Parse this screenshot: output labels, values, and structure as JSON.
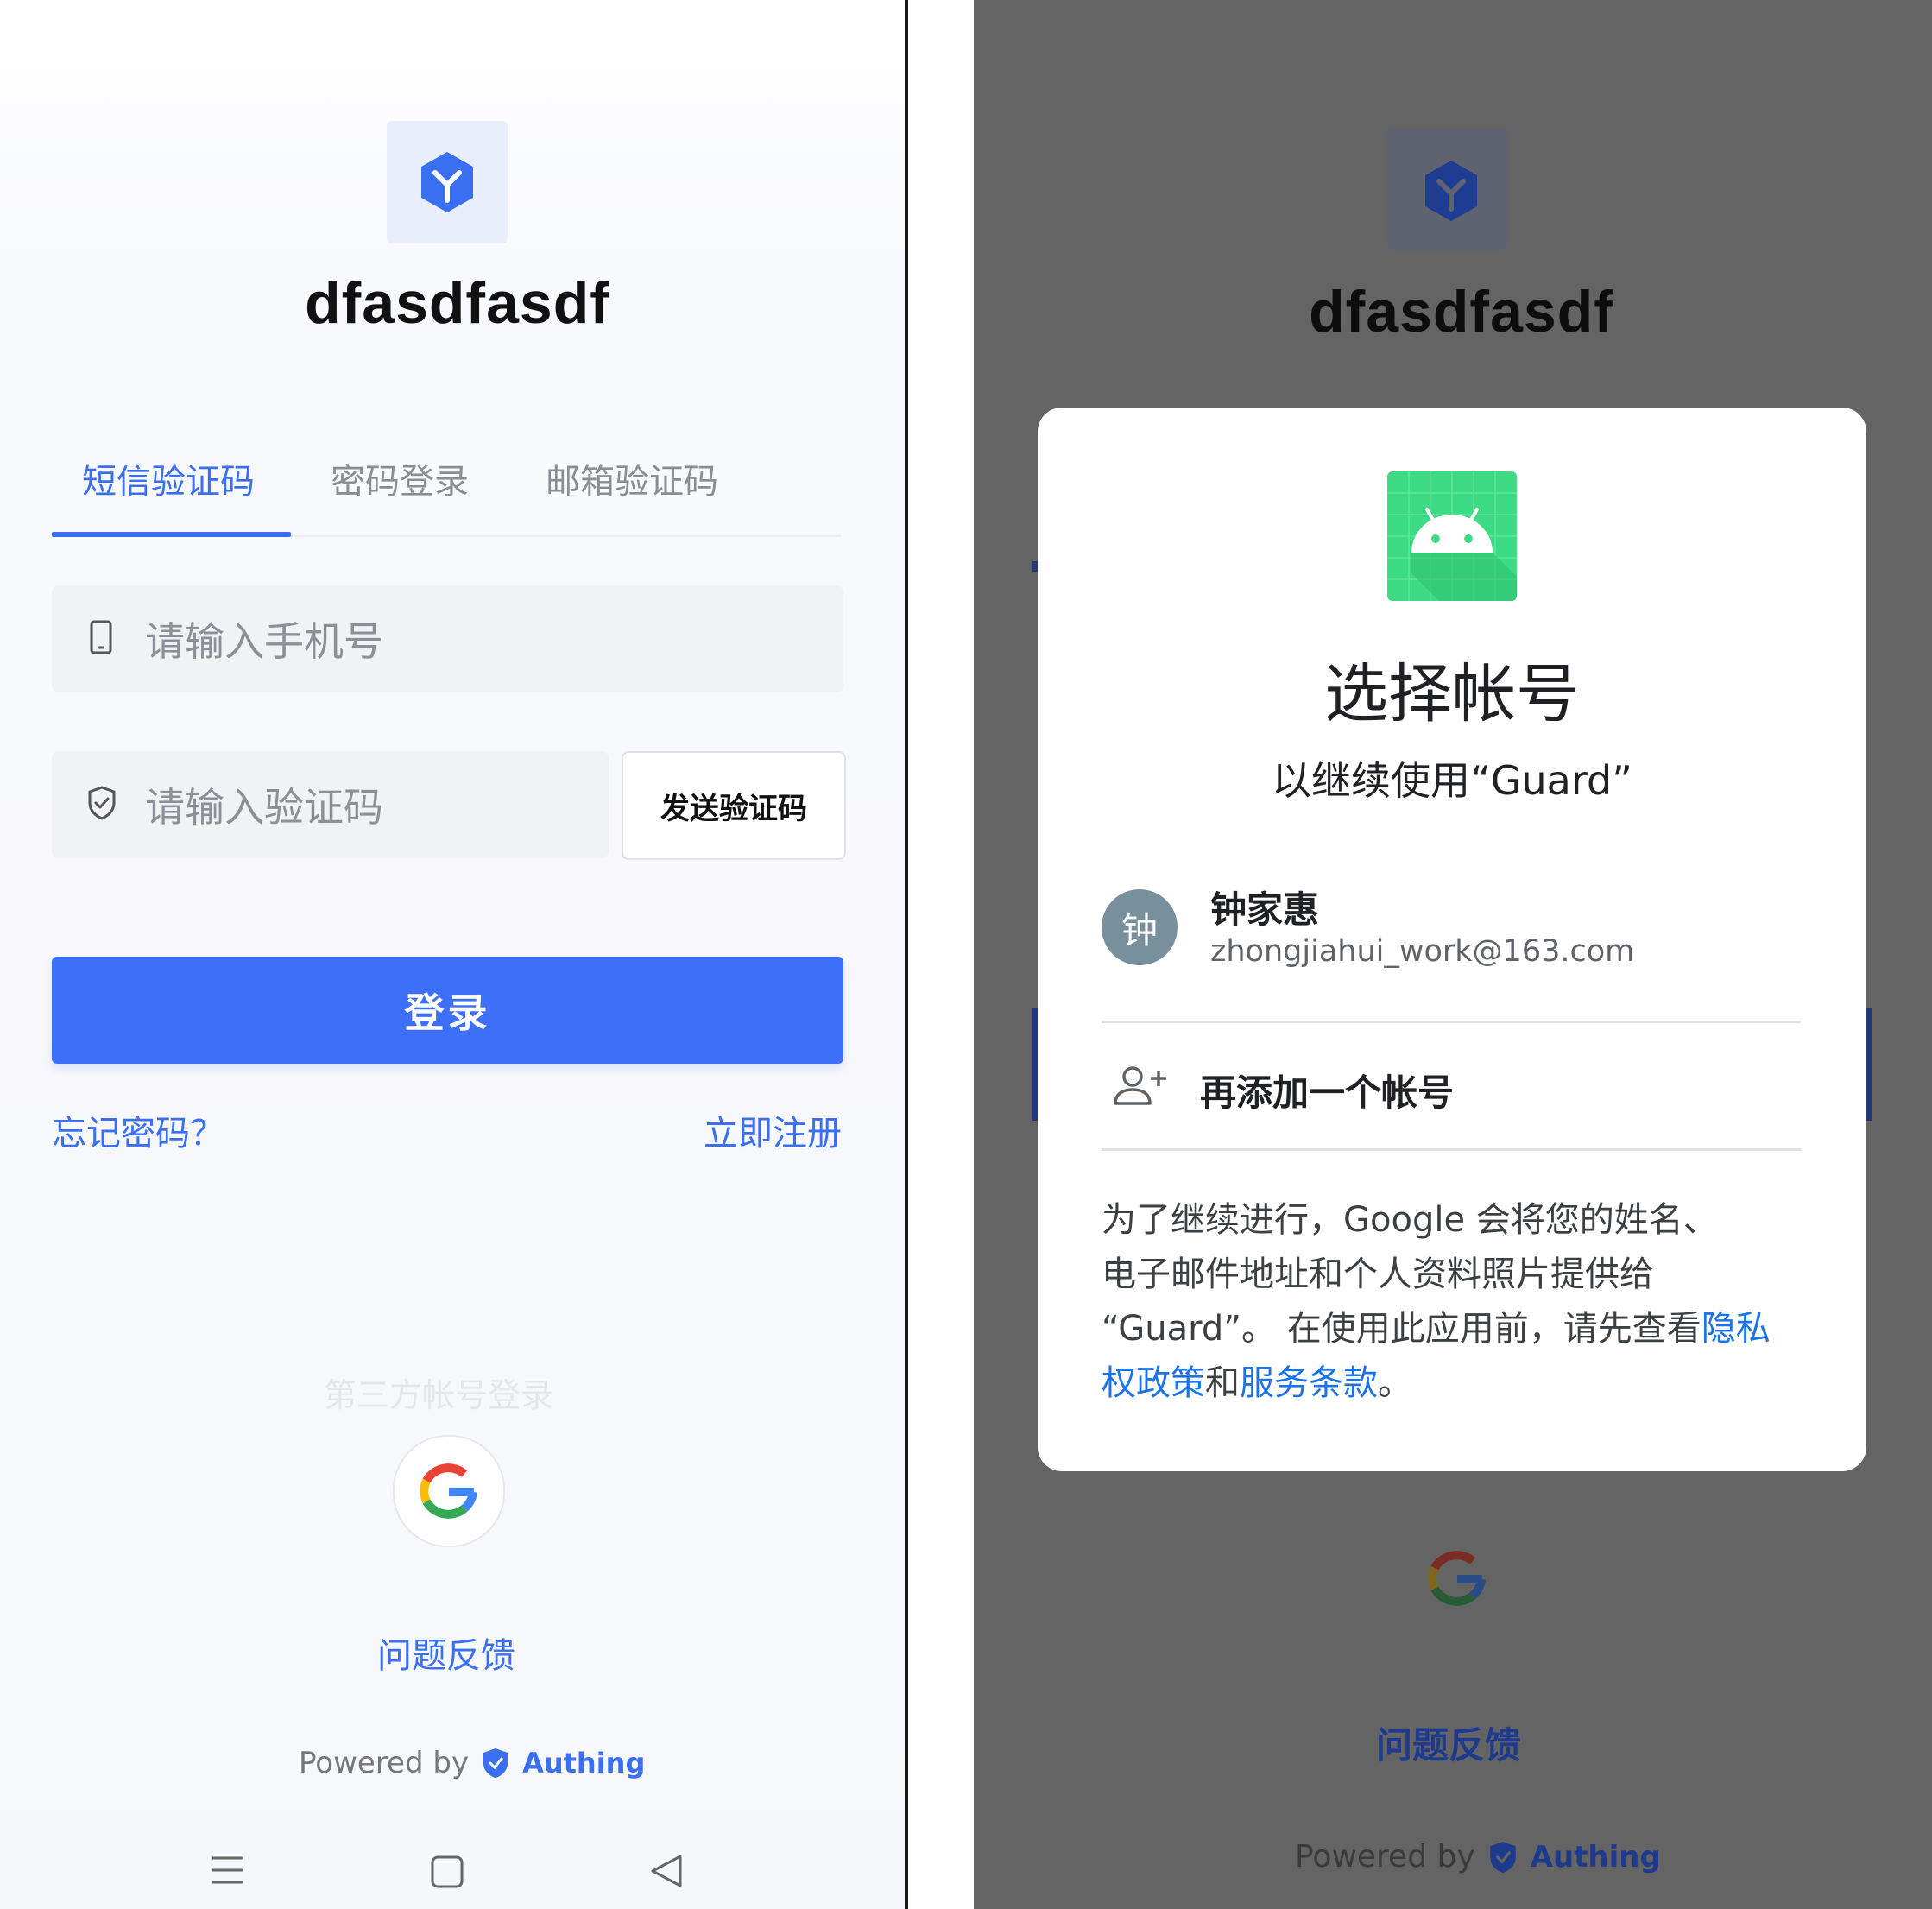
{
  "left": {
    "app_name": "dfasdfasdf",
    "tabs": [
      {
        "label": "短信验证码",
        "active": true
      },
      {
        "label": "密码登录",
        "active": false
      },
      {
        "label": "邮箱验证码",
        "active": false
      }
    ],
    "phone_input": {
      "placeholder": "请输入手机号",
      "icon": "mobile-phone-icon"
    },
    "code_input": {
      "placeholder": "请输入验证码",
      "icon": "shield-icon"
    },
    "send_code_label": "发送验证码",
    "login_label": "登录",
    "forgot_label": "忘记密码？",
    "register_label": "立即注册",
    "third_party_label": "第三方帐号登录",
    "feedback_label": "问题反馈",
    "powered_by": "Powered by",
    "brand": "Authing",
    "nav": [
      "menu-icon",
      "home-square-icon",
      "back-triangle-icon"
    ]
  },
  "right": {
    "app_name": "dfasdfasdf",
    "dialog": {
      "title": "选择帐号",
      "subtitle": "以继续使用“Guard”",
      "account": {
        "avatar_letter": "钟",
        "name": "钟家惠",
        "email": "zhongjiahui_work@163.com"
      },
      "add_account_label": "再添加一个帐号",
      "notice_line1": "为了继续进行，Google 会将您的姓名、",
      "notice_line2": "电子邮件地址和个人资料照片提供给",
      "notice_line3_prefix": "“Guard”。 在使用此应用前，请先查看",
      "privacy_link_part1": "隐私",
      "privacy_link_part2": "权政策",
      "notice_and": "和",
      "terms_link": "服务条款",
      "notice_end": "。"
    },
    "feedback_label": "问题反馈",
    "powered_by": "Powered by",
    "brand": "Authing"
  },
  "colors": {
    "accent": "#3e6ff8",
    "link": "#3a6ff2",
    "dim_overlay": "#646464",
    "android_green": "#3ddc84"
  }
}
